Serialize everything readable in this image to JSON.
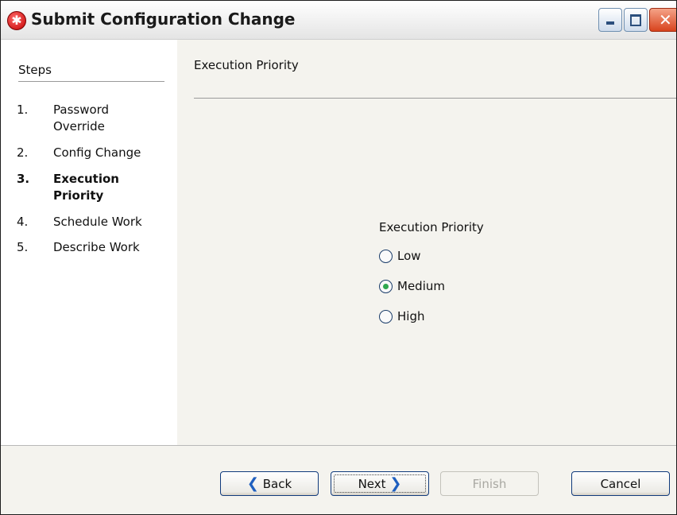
{
  "window": {
    "title": "Submit Configuration Change"
  },
  "sidebar": {
    "heading": "Steps",
    "steps": [
      {
        "num": "1.",
        "label": "Password Override",
        "current": false
      },
      {
        "num": "2.",
        "label": "Config Change",
        "current": false
      },
      {
        "num": "3.",
        "label": "Execution Priority",
        "current": true
      },
      {
        "num": "4.",
        "label": "Schedule Work",
        "current": false
      },
      {
        "num": "5.",
        "label": "Describe Work",
        "current": false
      }
    ]
  },
  "content": {
    "title": "Execution Priority",
    "group_label": "Execution Priority",
    "options": [
      {
        "label": "Low",
        "selected": false
      },
      {
        "label": "Medium",
        "selected": true
      },
      {
        "label": "High",
        "selected": false
      }
    ]
  },
  "footer": {
    "back_label": "Back",
    "next_label": "Next",
    "finish_label": "Finish",
    "cancel_label": "Cancel"
  },
  "colors": {
    "radio_selected": "#2fa84f",
    "button_border": "#103a7c",
    "close_button": "#d8431d"
  }
}
